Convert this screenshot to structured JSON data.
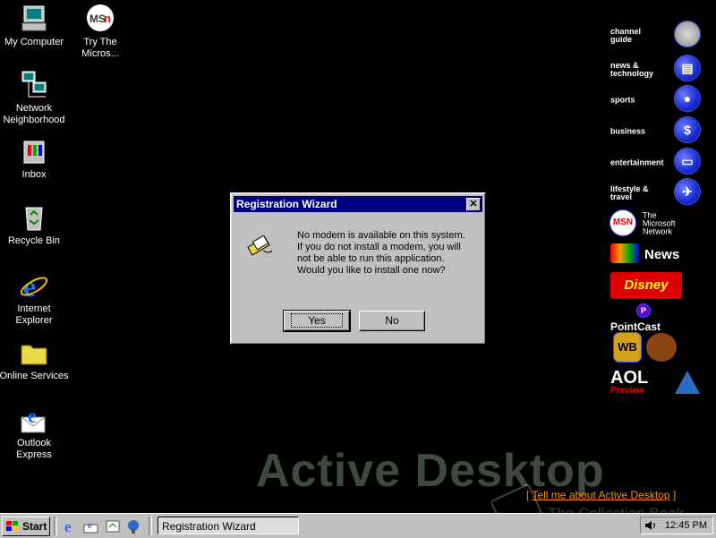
{
  "desktop_icons": [
    {
      "name": "my-computer",
      "label": "My Computer"
    },
    {
      "name": "msn",
      "label": "Try The Micros..."
    },
    {
      "name": "network-neighborhood",
      "label": "Network Neighborhood"
    },
    {
      "name": "inbox",
      "label": "Inbox"
    },
    {
      "name": "recycle-bin",
      "label": "Recycle Bin"
    },
    {
      "name": "internet-explorer",
      "label": "Internet Explorer"
    },
    {
      "name": "online-services",
      "label": "Online Services"
    },
    {
      "name": "outlook-express",
      "label": "Outlook Express"
    }
  ],
  "channels": [
    {
      "label": "channel guide"
    },
    {
      "label": "news & technology"
    },
    {
      "label": "sports"
    },
    {
      "label": "business",
      "glyph": "$"
    },
    {
      "label": "entertainment"
    },
    {
      "label": "lifestyle & travel"
    },
    {
      "label": "The Microsoft Network"
    },
    {
      "label": "News"
    },
    {
      "label": "PointCast"
    },
    {
      "label": "AOL",
      "sublabel": "Preview"
    }
  ],
  "active_desktop": {
    "title": "Active Desktop",
    "link_open": "[ ",
    "link_text": "Tell me about Active Desktop",
    "link_close": " ]"
  },
  "watermark": "The Collection Book",
  "dialog": {
    "title": "Registration Wizard",
    "close": "✕",
    "message": "No modem is available on this system. If you do not install a modem, you will not be able to run this application. Would you like to install one now?",
    "yes_label": "Yes",
    "no_label": "No"
  },
  "taskbar": {
    "start_label": "Start",
    "task_label": "Registration Wizard",
    "clock": "12:45 PM"
  }
}
